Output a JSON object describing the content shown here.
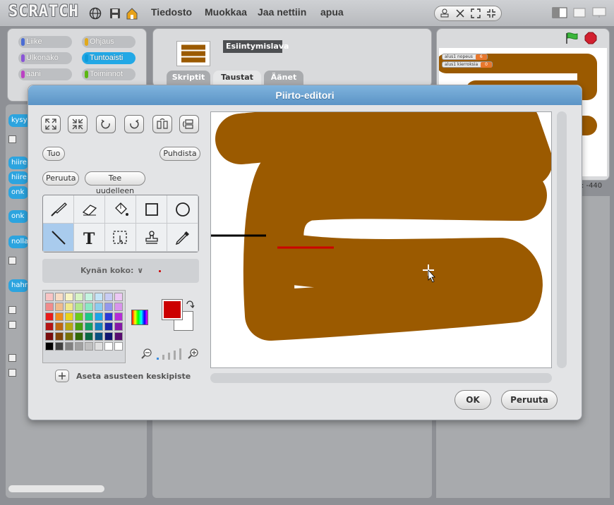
{
  "app": {
    "logo_text": "SCRATCH"
  },
  "menu": [
    "Tiedosto",
    "Muokkaa",
    "Jaa nettiin",
    "apua"
  ],
  "categories": [
    {
      "label": "Liike",
      "color": "#4a6cd4"
    },
    {
      "label": "Ohjaus",
      "color": "#e1a91a"
    },
    {
      "label": "Ulkonäkö",
      "color": "#8a55d7"
    },
    {
      "label": "Tuntoaisti",
      "color": "#0e9ad8",
      "active": true
    },
    {
      "label": "ääni",
      "color": "#bb42c3"
    },
    {
      "label": "Toiminnot",
      "color": "#5cb712"
    }
  ],
  "sprite": {
    "name": "Esiintymislava"
  },
  "tabs": [
    "Skriptit",
    "Taustat",
    "Äänet"
  ],
  "stage": {
    "monitors": [
      {
        "label": "alus1 nopeus",
        "value": "6"
      },
      {
        "label": "alus1 kierroksia",
        "value": "0"
      }
    ],
    "coord_text": "x: -440"
  },
  "left_blocks": [
    "kysy",
    "hiire",
    "hiire",
    "onk",
    "onk",
    "nolla",
    "hahm"
  ],
  "dialog": {
    "title": "Piirto-editori",
    "buttons": {
      "import": "Tuo",
      "clear": "Puhdista",
      "undo": "Peruuta",
      "redo": "Tee uudelleen",
      "ok": "OK",
      "cancel": "Peruuta"
    },
    "pen_size_label": "Kynän koko:",
    "set_center_label": "Aseta asusteen keskipiste",
    "selected_tool": "line-tool",
    "foreground_color": "#cc0000",
    "background_color": "#ffffff",
    "palette": [
      "#f8c4c4",
      "#f8dcc4",
      "#f8f4c4",
      "#d8f4c4",
      "#c4f4e0",
      "#c4e4f8",
      "#c8ccf4",
      "#ecc8f4",
      "#f08c8c",
      "#f0bc8c",
      "#f0e88c",
      "#b4e88c",
      "#8ce8c4",
      "#8cccf0",
      "#9498ec",
      "#d894ec",
      "#e81c1c",
      "#f08c1c",
      "#e8d41c",
      "#6ccc1c",
      "#1cc888",
      "#1ca4e8",
      "#2c38d8",
      "#b42cd8",
      "#b41414",
      "#c06810",
      "#b8a810",
      "#48a010",
      "#10a068",
      "#1080c0",
      "#1c24a8",
      "#8418a8",
      "#780c0c",
      "#804408",
      "#787008",
      "#306808",
      "#086844",
      "#085080",
      "#101470",
      "#580c70",
      "#000000",
      "#404040",
      "#808080",
      "#a0a0a0",
      "#c0c0c0",
      "#e0e0e0",
      "#ffffff",
      "#ffffff"
    ],
    "track_color": "#9b5a00",
    "start_line_color": "#000000",
    "finish_line_color": "#cc0000"
  }
}
